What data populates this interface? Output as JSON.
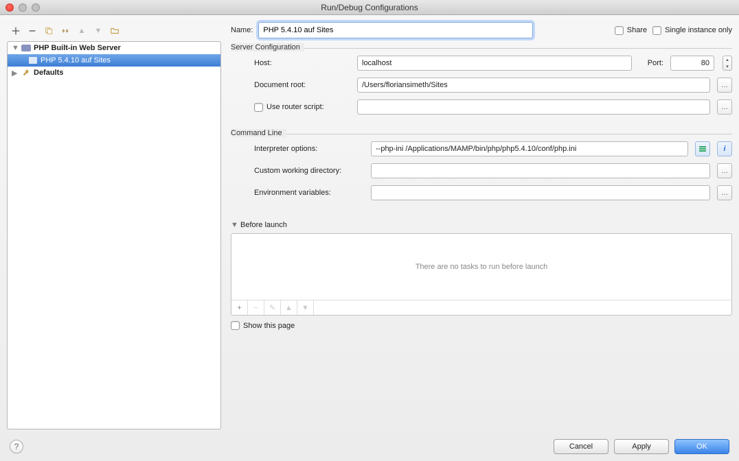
{
  "window": {
    "title": "Run/Debug Configurations"
  },
  "tree": {
    "root1": {
      "label": "PHP Built-in Web Server"
    },
    "root1_child": {
      "label": "PHP 5.4.10 auf Sites"
    },
    "root2": {
      "label": "Defaults"
    }
  },
  "form": {
    "name_label": "Name:",
    "name_value": "PHP 5.4.10 auf Sites",
    "share_label": "Share",
    "single_instance_label": "Single instance only",
    "section_server": "Server Configuration",
    "host_label": "Host:",
    "host_value": "localhost",
    "port_label": "Port:",
    "port_value": "80",
    "docroot_label": "Document root:",
    "docroot_value": "/Users/floriansimeth/Sites",
    "router_label": "Use router script:",
    "router_value": "",
    "section_cmd": "Command Line",
    "interp_label": "Interpreter options:",
    "interp_value": "--php-ini /Applications/MAMP/bin/php/php5.4.10/conf/php.ini",
    "cwd_label": "Custom working directory:",
    "cwd_value": "",
    "env_label": "Environment variables:",
    "env_value": "",
    "before_launch_label": "Before launch",
    "before_launch_empty": "There are no tasks to run before launch",
    "show_page_label": "Show this page"
  },
  "buttons": {
    "cancel": "Cancel",
    "apply": "Apply",
    "ok": "OK"
  }
}
